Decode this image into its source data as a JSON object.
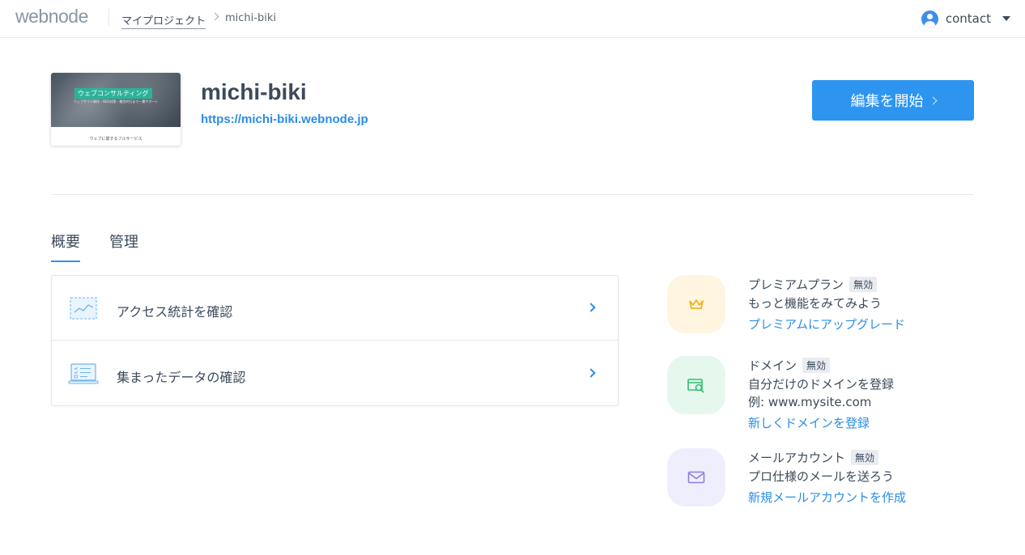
{
  "header": {
    "logo": "webnode",
    "breadcrumb": {
      "root": "マイプロジェクト",
      "current": "michi-biki"
    },
    "user": {
      "name": "contact"
    }
  },
  "project": {
    "thumbnail": {
      "banner": "ウェブコンサルティング",
      "subtext": "ウェブサイト制作・SEO対策・運用代行まで一貫サポート",
      "caption": "ウェブに関するフルサービス"
    },
    "title": "michi-biki",
    "url": "https://michi-biki.webnode.jp",
    "edit_button": "編集を開始"
  },
  "tabs": [
    {
      "label": "概要",
      "active": true
    },
    {
      "label": "管理",
      "active": false
    }
  ],
  "actions": [
    {
      "label": "アクセス統計を確認",
      "icon": "chart-icon"
    },
    {
      "label": "集まったデータの確認",
      "icon": "laptop-list-icon"
    }
  ],
  "features": [
    {
      "title": "プレミアムプラン",
      "badge": "無効",
      "desc": [
        "もっと機能をみてみよう"
      ],
      "link": "プレミアムにアップグレード",
      "icon": "crown-icon",
      "bg": "#fff5e0",
      "color": "#f2b31c"
    },
    {
      "title": "ドメイン",
      "badge": "無効",
      "desc": [
        "自分だけのドメインを登録",
        "例: www.mysite.com"
      ],
      "link": "新しくドメインを登録",
      "icon": "domain-search-icon",
      "bg": "#e6f8ee",
      "color": "#2fbf71"
    },
    {
      "title": "メールアカウント",
      "badge": "無効",
      "desc": [
        "プロ仕様のメールを送ろう"
      ],
      "link": "新規メールアカウントを作成",
      "icon": "mail-icon",
      "bg": "#efeefc",
      "color": "#8a7fe0"
    }
  ],
  "colors": {
    "accent": "#2d95f0",
    "link": "#2a8de8",
    "text": "#3c4a5a"
  }
}
